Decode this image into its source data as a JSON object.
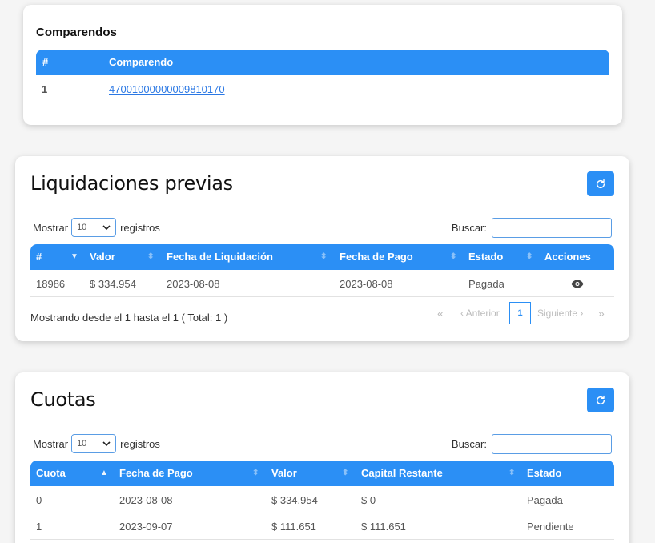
{
  "comparendos": {
    "title": "Comparendos",
    "headers": [
      "#",
      "Comparendo"
    ],
    "rows": [
      {
        "num": "1",
        "comparendo": "47001000000009810170"
      }
    ]
  },
  "liquidaciones": {
    "title": "Liquidaciones previas",
    "show_label": "Mostrar",
    "page_size": "10",
    "records_label": "registros",
    "search_label": "Buscar:",
    "headers": [
      "#",
      "Valor",
      "Fecha de Liquidación",
      "Fecha de Pago",
      "Estado",
      "Acciones"
    ],
    "rows": [
      {
        "id": "18986",
        "valor": "$ 334.954",
        "fecha_liq": "2023-08-08",
        "fecha_pago": "2023-08-08",
        "estado": "Pagada"
      }
    ],
    "info": "Mostrando desde el 1 hasta el 1 ( Total: 1 )",
    "pagination": {
      "first": "«",
      "prev": "‹ Anterior",
      "current": "1",
      "next": "Siguiente ›",
      "last": "»"
    }
  },
  "cuotas": {
    "title": "Cuotas",
    "show_label": "Mostrar",
    "page_size": "10",
    "records_label": "registros",
    "search_label": "Buscar:",
    "headers": [
      "Cuota",
      "Fecha de Pago",
      "Valor",
      "Capital Restante",
      "Estado"
    ],
    "rows": [
      {
        "cuota": "0",
        "fecha": "2023-08-08",
        "valor": "$ 334.954",
        "capital": "$ 0",
        "estado": "Pagada"
      },
      {
        "cuota": "1",
        "fecha": "2023-09-07",
        "valor": "$ 111.651",
        "capital": "$ 111.651",
        "estado": "Pendiente"
      }
    ]
  },
  "colors": {
    "primary": "#2b8ff5",
    "link": "#2b78e4"
  },
  "icons": {
    "refresh": "refresh-icon",
    "view": "eye-icon",
    "dropdown": "chevron-down-icon"
  }
}
